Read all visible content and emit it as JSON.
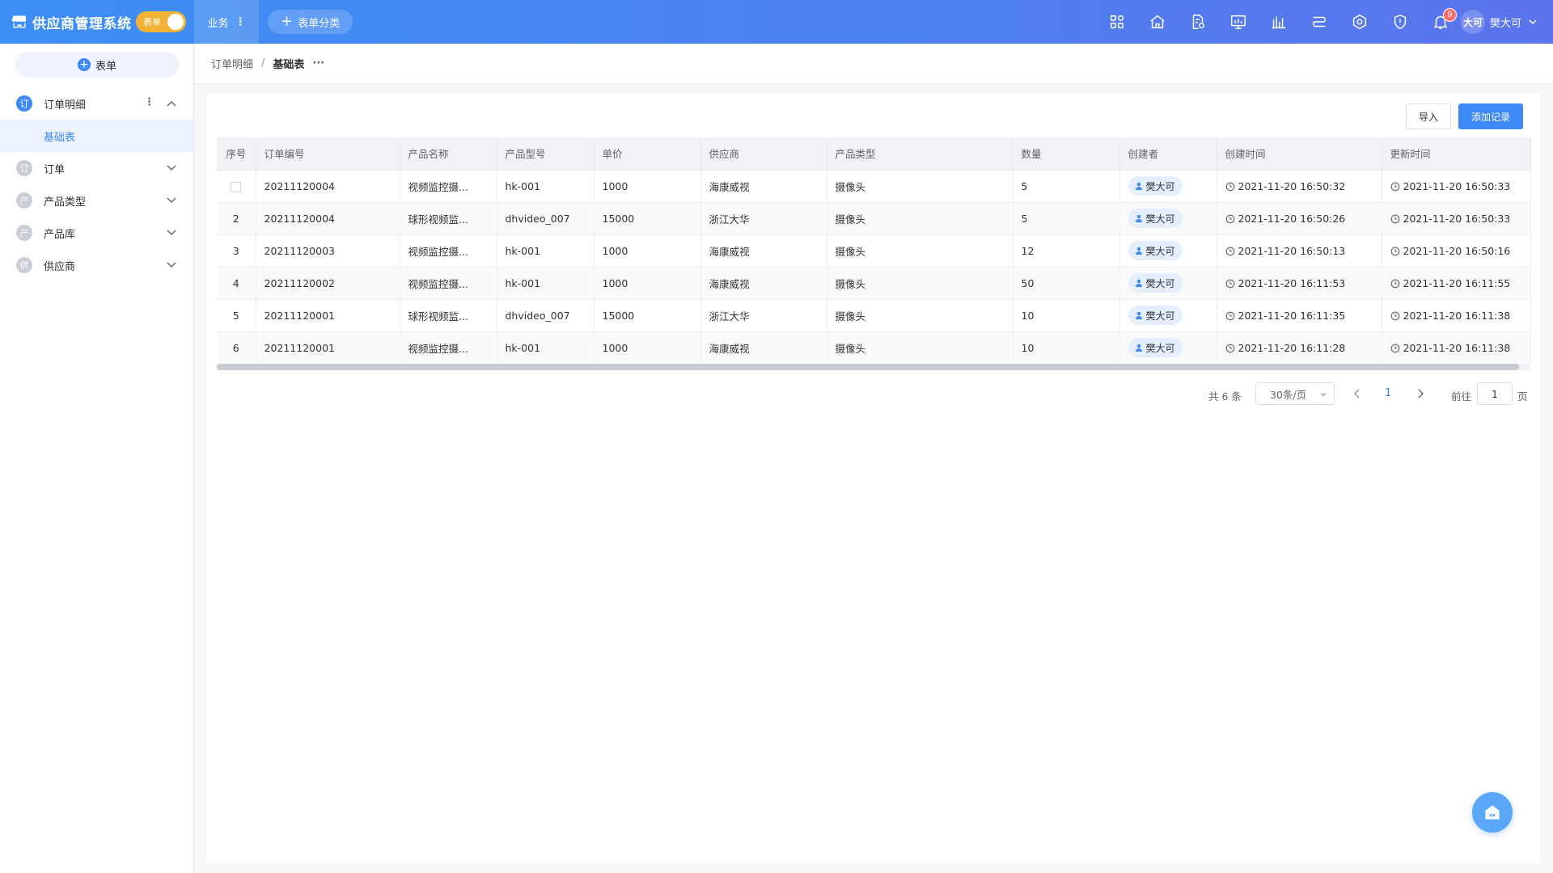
{
  "header": {
    "title": "供应商管理系统",
    "toggle_label": "表单",
    "business_label": "业务",
    "add_category_label": "表单分类",
    "icons": [
      "apps-icon",
      "home-icon",
      "file-settings-icon",
      "chart-board-icon",
      "bar-chart-icon",
      "process-icon",
      "network-icon",
      "shield-icon",
      "bell-icon"
    ],
    "notification_count": "9",
    "user_avatar_text": "大可",
    "user_name": "樊大可"
  },
  "sidebar": {
    "new_form_label": "表单",
    "menu": [
      {
        "icon": "订",
        "label": "订单明细",
        "expanded": true,
        "sub": [
          {
            "label": "基础表"
          }
        ]
      },
      {
        "icon": "订",
        "label": "订单"
      },
      {
        "icon": "产",
        "label": "产品类型"
      },
      {
        "icon": "产",
        "label": "产品库"
      },
      {
        "icon": "供",
        "label": "供应商"
      }
    ]
  },
  "breadcrumb": {
    "parent": "订单明细",
    "separator": "/",
    "current": "基础表"
  },
  "toolbar": {
    "import_label": "导入",
    "add_label": "添加记录"
  },
  "table": {
    "columns": [
      "序号",
      "订单编号",
      "产品名称",
      "产品型号",
      "单价",
      "供应商",
      "产品类型",
      "数量",
      "创建者",
      "创建时间",
      "更新时间"
    ],
    "rows": [
      {
        "idx": "",
        "order_no": "20211120004",
        "product": "视频监控摄...",
        "model": "hk-001",
        "price": "1000",
        "supplier": "海康威视",
        "type": "摄像头",
        "qty": "5",
        "creator": "樊大可",
        "created": "2021-11-20 16:50:32",
        "updated": "2021-11-20 16:50:33"
      },
      {
        "idx": "2",
        "order_no": "20211120004",
        "product": "球形视频监...",
        "model": "dhvideo_007",
        "price": "15000",
        "supplier": "浙江大华",
        "type": "摄像头",
        "qty": "5",
        "creator": "樊大可",
        "created": "2021-11-20 16:50:26",
        "updated": "2021-11-20 16:50:33"
      },
      {
        "idx": "3",
        "order_no": "20211120003",
        "product": "视频监控摄...",
        "model": "hk-001",
        "price": "1000",
        "supplier": "海康威视",
        "type": "摄像头",
        "qty": "12",
        "creator": "樊大可",
        "created": "2021-11-20 16:50:13",
        "updated": "2021-11-20 16:50:16"
      },
      {
        "idx": "4",
        "order_no": "20211120002",
        "product": "视频监控摄...",
        "model": "hk-001",
        "price": "1000",
        "supplier": "海康威视",
        "type": "摄像头",
        "qty": "50",
        "creator": "樊大可",
        "created": "2021-11-20 16:11:53",
        "updated": "2021-11-20 16:11:55"
      },
      {
        "idx": "5",
        "order_no": "20211120001",
        "product": "球形视频监...",
        "model": "dhvideo_007",
        "price": "15000",
        "supplier": "浙江大华",
        "type": "摄像头",
        "qty": "10",
        "creator": "樊大可",
        "created": "2021-11-20 16:11:35",
        "updated": "2021-11-20 16:11:38"
      },
      {
        "idx": "6",
        "order_no": "20211120001",
        "product": "视频监控摄...",
        "model": "hk-001",
        "price": "1000",
        "supplier": "海康威视",
        "type": "摄像头",
        "qty": "10",
        "creator": "樊大可",
        "created": "2021-11-20 16:11:28",
        "updated": "2021-11-20 16:11:38"
      }
    ]
  },
  "pagination": {
    "total": "共 6 条",
    "page_size": "30条/页",
    "current_page": "1",
    "goto_label": "前往",
    "goto_value": "1",
    "page_unit": "页"
  },
  "colors": {
    "primary": "#3d8af7",
    "header_start": "#3c8ff5",
    "header_end": "#5b74ec",
    "toggle": "#f2b335",
    "badge": "#f56c6c"
  }
}
